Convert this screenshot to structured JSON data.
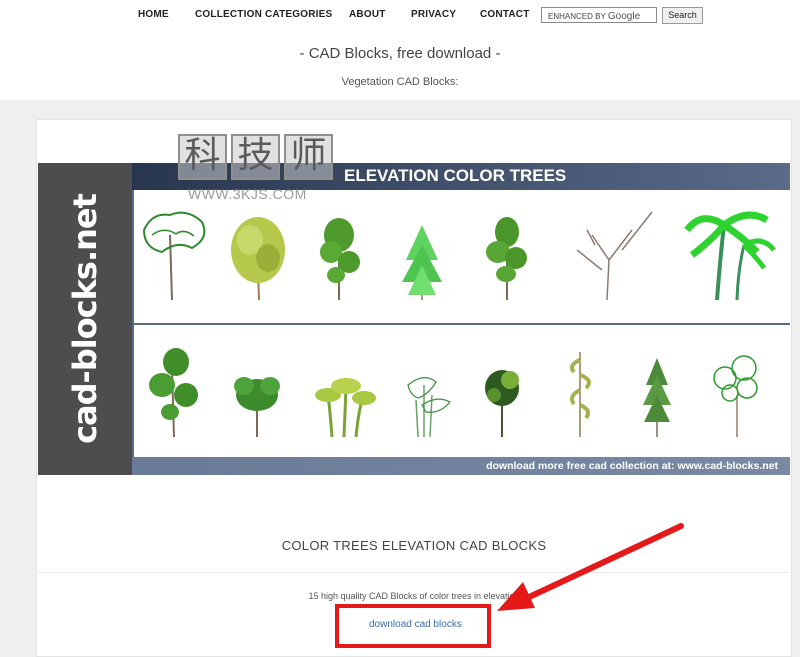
{
  "nav": {
    "items": [
      "HOME",
      "COLLECTION CATEGORIES",
      "ABOUT",
      "PRIVACY",
      "CONTACT"
    ],
    "search_placeholder_small": "ENHANCED BY",
    "search_placeholder_brand": "Google",
    "search_button": "Search"
  },
  "site": {
    "title": "- CAD Blocks, free download -",
    "subtitle": "Vegetation CAD Blocks:"
  },
  "banner": {
    "side_text": "cad-blocks.net",
    "header": "ELEVATION COLOR TREES",
    "footer": "download more free cad collection at: www.cad-blocks.net"
  },
  "watermark": {
    "chars": [
      "科",
      "技",
      "师"
    ],
    "url": "WWW.3KJS.COM"
  },
  "content": {
    "section_title": "COLOR TREES ELEVATION CAD BLOCKS",
    "description": "15 high quality CAD Blocks of color trees in elevation",
    "download_link": "download cad blocks"
  },
  "colors": {
    "annotation_red": "#e41a1a",
    "link": "#3c6ca8",
    "banner_dark": "#4d4d4f",
    "banner_header": "#28364f"
  }
}
